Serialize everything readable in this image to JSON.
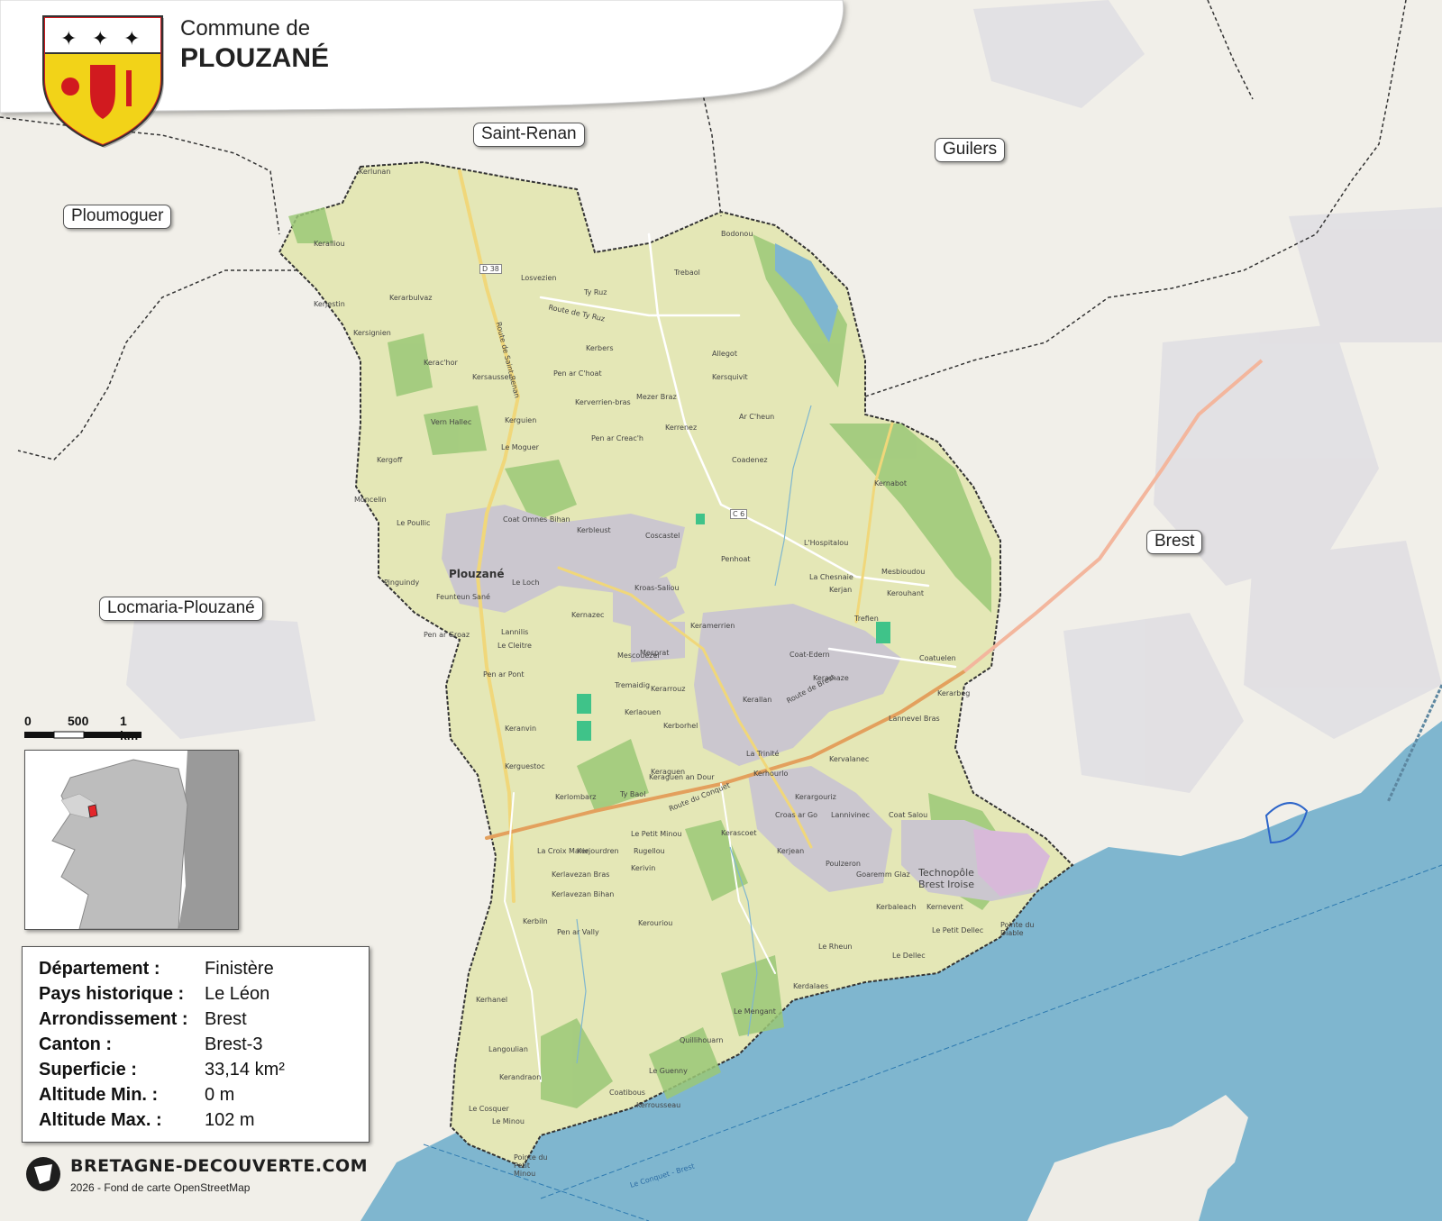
{
  "header": {
    "subtitle": "Commune de",
    "title": "PLOUZANÉ"
  },
  "neighbors": [
    {
      "name": "Saint-Renan"
    },
    {
      "name": "Guilers"
    },
    {
      "name": "Ploumoguer"
    },
    {
      "name": "Brest"
    },
    {
      "name": "Locmaria-Plouzané"
    }
  ],
  "places": {
    "plouzane_town": "Plouzané",
    "technopole": "Technopôle Brest Iroise",
    "la_trinite": "La Trinité",
    "mescouezel": "Mescouezel",
    "pointe_minou": "Pointe du Petit Minou",
    "pointe_diable": "Pointe du Diable",
    "le_conquet_brest": "Le Conquet - Brest",
    "others": [
      "Kerlunan",
      "Keralliou",
      "Losvezien",
      "Ty Ruz",
      "Trebaol",
      "Bodonou",
      "Kerbers",
      "Allegot",
      "Kersquivit",
      "Mezer Braz",
      "Ar C'heun",
      "Kerrenez",
      "Coadenez",
      "Le Moguer",
      "Vern Hallec",
      "Kerguien",
      "Kergoff",
      "Penhoat",
      "L'Hospitalou",
      "La Chesnaie",
      "Kernabot",
      "Kerjan",
      "Mesbioudou",
      "Kerouhant",
      "Trefien",
      "Coat-Edern",
      "Keramaze",
      "Coatuelen",
      "Kerarbeg",
      "Lannevel Bras",
      "Kervalanec",
      "Kerallan",
      "Kerhourlo",
      "Kerargouriz",
      "Coat Salou",
      "Croas ar Go",
      "Lannivinec",
      "Kerascoet",
      "Kerjean",
      "Poulzeron",
      "Goaremm Glaz",
      "Kerbaleach",
      "Kernevent",
      "Le Petit Dellec",
      "Le Dellec",
      "Le Rheun",
      "Kerdalaes",
      "Le Mengant",
      "Quillihouarn",
      "Le Guenny",
      "Kerrousseau",
      "Coatibous",
      "Kerouriou",
      "Kerhanel",
      "Langoulian",
      "Kerandraon",
      "Le Cosquer",
      "Le Minou",
      "Kerbiln",
      "Pen ar Vally",
      "Kerlavezan Bras",
      "Kerlavezan Bihan",
      "Kerjourdren",
      "Rugellou",
      "Kerivin",
      "Le Petit Minou",
      "La Croix Marie",
      "Kerlombarz",
      "Ty Baol",
      "Keraguen",
      "Keraguen an Dour",
      "Kerlaouen",
      "Kerguestoc",
      "Keranvin",
      "Pen ar Pont",
      "Tremaidig",
      "Kerarrouz",
      "Kerborhel",
      "Mesprat",
      "Keramerrien",
      "Kernazec",
      "Lannilis",
      "Le Cleitre",
      "Pen ar Groaz",
      "Feunteun Sané",
      "Pinguindy",
      "Le Poullic",
      "Moncelin",
      "Kroas-Saliou",
      "Coscastel",
      "Kerbleust",
      "Coat Omnes Bihan",
      "Le Loch",
      "Kerverrien-bras",
      "Pen ar Creac'h",
      "Pen ar C'hoat",
      "Kersausset",
      "Kerac'hor",
      "Kersignien",
      "Kerarbulvaz",
      "Kerjestin"
    ]
  },
  "roads": [
    "D 38",
    "C 6",
    "Route de Ty Ruz",
    "Route de Brest",
    "Route du Conquet",
    "Route de Saint-Renan"
  ],
  "scale": {
    "ticks": [
      "0",
      "500",
      "1 km"
    ]
  },
  "info": {
    "rows": [
      {
        "label": "Département :",
        "value": "Finistère"
      },
      {
        "label": "Pays historique :",
        "value": "Le Léon"
      },
      {
        "label": "Arrondissement :",
        "value": "Brest"
      },
      {
        "label": "Canton :",
        "value": "Brest-3"
      },
      {
        "label": "Superficie :",
        "value": "33,14 km²"
      },
      {
        "label": "Altitude Min. :",
        "value": "0 m"
      },
      {
        "label": "Altitude Max. :",
        "value": "102 m"
      }
    ]
  },
  "footer": {
    "site": "BRETAGNE-DECOUVERTE.COM",
    "credit": "2026 - Fond de carte OpenStreetMap"
  },
  "colors": {
    "sea": "#7fb6cf",
    "commune_fill": "#e4e7b6",
    "forest": "#8fc46a",
    "urban": "#c9c6cc",
    "land": "#f1efe9",
    "highlight": "#e3262a",
    "shield_yellow": "#f2d318",
    "shield_red": "#d11a1f"
  }
}
